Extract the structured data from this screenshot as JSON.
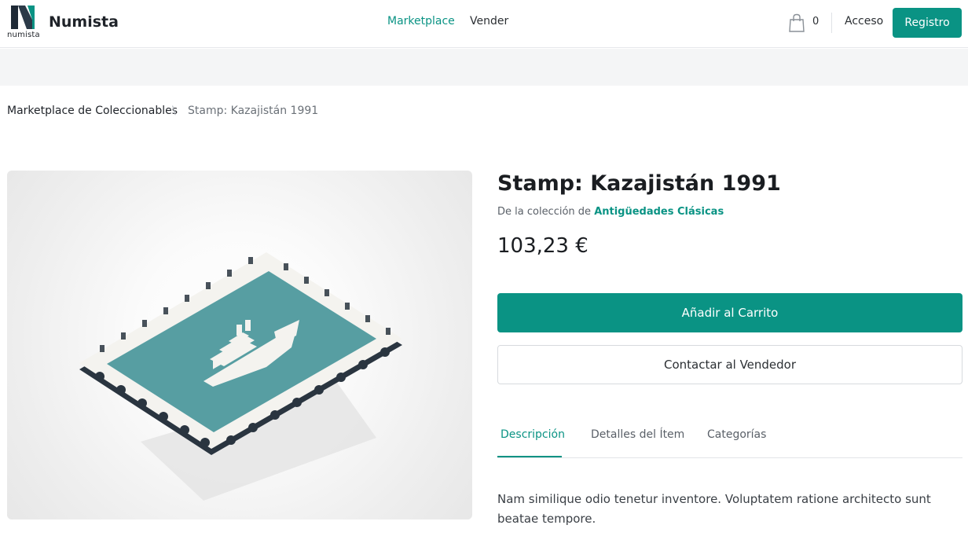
{
  "header": {
    "logo_small_text_a": "nu",
    "logo_small_text_b": "mista",
    "brand": "Numista",
    "nav": [
      "Marketplace",
      "Vender"
    ],
    "cart_count": "0",
    "login_label": "Acceso",
    "register_label": "Registro",
    "accent_color": "#0a9384"
  },
  "breadcrumb": {
    "items": [
      "Marketplace de Coleccionables",
      "Stamp: Kazajistán 1991"
    ],
    "separator": "\\"
  },
  "product": {
    "title": "Stamp: Kazajistán 1991",
    "collection_prefix": "De la colección de",
    "collection_name": "Antigüedades Clásicas",
    "price": "103,23 €",
    "add_to_cart_label": "Añadir al Carrito",
    "contact_label": "Contactar al Vendedor",
    "image_icon": "stamp-with-ship-illustration"
  },
  "tabs": {
    "items": [
      "Descripción",
      "Detalles del Ítem",
      "Categorías"
    ],
    "active": "Descripción"
  },
  "description": "Nam similique odio tenetur inventore. Voluptatem ratione architecto sunt beatae tempore."
}
